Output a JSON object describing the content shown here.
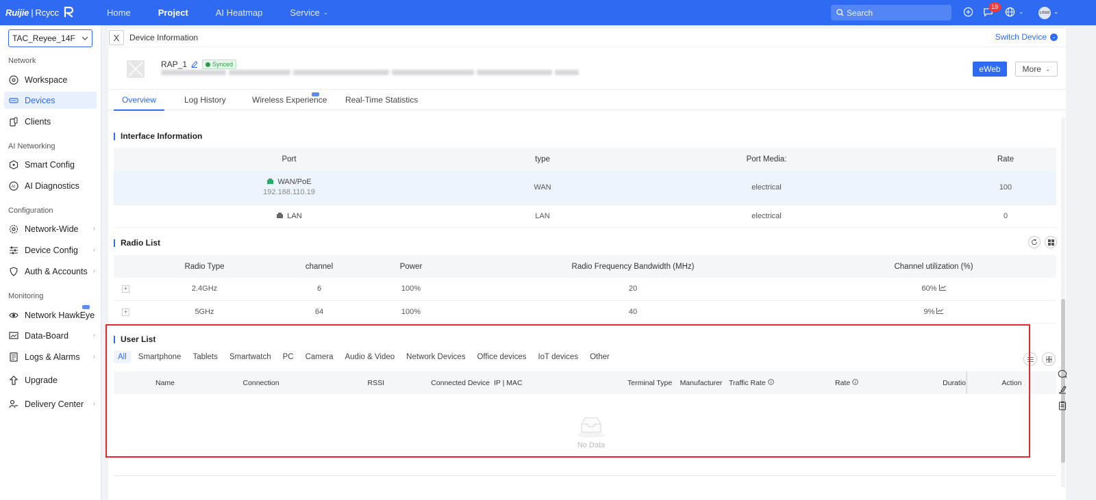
{
  "topbar": {
    "logo_brand": "Ruijie",
    "logo_sep": "|",
    "logo_product": "Rcycc",
    "nav": [
      {
        "label": "Home"
      },
      {
        "label": "Project"
      },
      {
        "label": "AI Heatmap"
      },
      {
        "label": "Service"
      }
    ],
    "search_placeholder": "Search",
    "notification_count": "19",
    "avatar_text": "LOGO"
  },
  "sidebar": {
    "project": "TAC_Reyee_14F",
    "groups": {
      "network": "Network",
      "ai_networking": "AI Networking",
      "configuration": "Configuration",
      "monitoring": "Monitoring"
    },
    "items": {
      "workspace": "Workspace",
      "devices": "Devices",
      "clients": "Clients",
      "smart_config": "Smart Config",
      "ai_diagnostics": "AI Diagnostics",
      "network_wide": "Network-Wide",
      "device_config": "Device Config",
      "auth_accounts": "Auth & Accounts",
      "network_hawkeye": "Network HawkEye",
      "data_board": "Data-Board",
      "logs_alarms": "Logs & Alarms",
      "upgrade": "Upgrade",
      "delivery_center": "Delivery Center"
    }
  },
  "header": {
    "close": "X",
    "title": "Device Information",
    "switch_device": "Switch Device"
  },
  "device": {
    "name": "RAP_1",
    "status": "Synced",
    "eweb": "eWeb",
    "more": "More"
  },
  "tabs": {
    "overview": "Overview",
    "log_history": "Log History",
    "wireless_experience": "Wireless Experience",
    "realtime": "Real-Time Statistics"
  },
  "interface": {
    "title": "Interface Information",
    "headers": {
      "port": "Port",
      "type": "type",
      "media": "Port Media:",
      "rate": "Rate"
    },
    "rows": [
      {
        "port": "WAN/PoE",
        "ip": "192.168.110.19",
        "type": "WAN",
        "media": "electrical",
        "rate": "100",
        "status_color": "#2aa869"
      },
      {
        "port": "LAN",
        "ip": "",
        "type": "LAN",
        "media": "electrical",
        "rate": "0",
        "status_color": "#666666"
      }
    ]
  },
  "radio": {
    "title": "Radio List",
    "headers": {
      "expand": "",
      "type": "Radio Type",
      "channel": "channel",
      "power": "Power",
      "bandwidth": "Radio Frequency Bandwidth (MHz)",
      "utilization": "Channel utilization (%)"
    },
    "rows": [
      {
        "expand": "+",
        "type": "2.4GHz",
        "channel": "6",
        "power": "100%",
        "bandwidth": "20",
        "utilization": "60%"
      },
      {
        "expand": "+",
        "type": "5GHz",
        "channel": "64",
        "power": "100%",
        "bandwidth": "40",
        "utilization": "9%"
      }
    ]
  },
  "userlist": {
    "title": "User List",
    "filters": [
      "All",
      "Smartphone",
      "Tablets",
      "Smartwatch",
      "PC",
      "Camera",
      "Audio & Video",
      "Network Devices",
      "Office devices",
      "IoT devices",
      "Other"
    ],
    "headers": {
      "name": "Name",
      "connection": "Connection",
      "rssi": "RSSI",
      "connected_device": "Connected Device",
      "ip_mac": "IP | MAC",
      "terminal_type": "Terminal Type",
      "manufacturer": "Manufacturer",
      "traffic_rate": "Traffic Rate",
      "rate": "Rate",
      "duration": "Duratio",
      "action": "Action"
    },
    "empty": "No Data"
  },
  "colors": {
    "accent": "#2f6bf2",
    "highlight_box": "#e5272d"
  }
}
